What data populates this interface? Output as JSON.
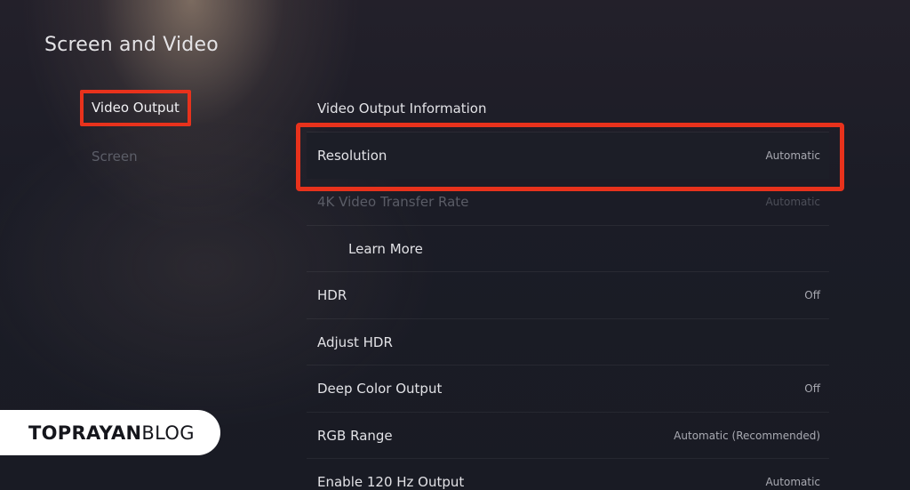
{
  "header": {
    "title": "Screen and Video"
  },
  "sidebar": {
    "items": [
      {
        "label": "Video Output",
        "selected": true
      },
      {
        "label": "Screen",
        "selected": false
      }
    ]
  },
  "settings": {
    "rows": [
      {
        "label": "Video Output Information",
        "value": ""
      },
      {
        "label": "Resolution",
        "value": "Automatic",
        "focused": true
      },
      {
        "label": "4K Video Transfer Rate",
        "value": "Automatic",
        "disabled": true
      },
      {
        "label": "Learn More",
        "value": ""
      },
      {
        "label": "HDR",
        "value": "Off"
      },
      {
        "label": "Adjust HDR",
        "value": ""
      },
      {
        "label": "Deep Color Output",
        "value": "Off"
      },
      {
        "label": "RGB Range",
        "value": "Automatic (Recommended)"
      },
      {
        "label": "Enable 120 Hz Output",
        "value": "Automatic"
      }
    ]
  },
  "watermark": {
    "bold": "TOPRAYAN",
    "regular": "BLOG"
  },
  "colors": {
    "highlight": "#e8321c",
    "background": "#1b1c26"
  }
}
